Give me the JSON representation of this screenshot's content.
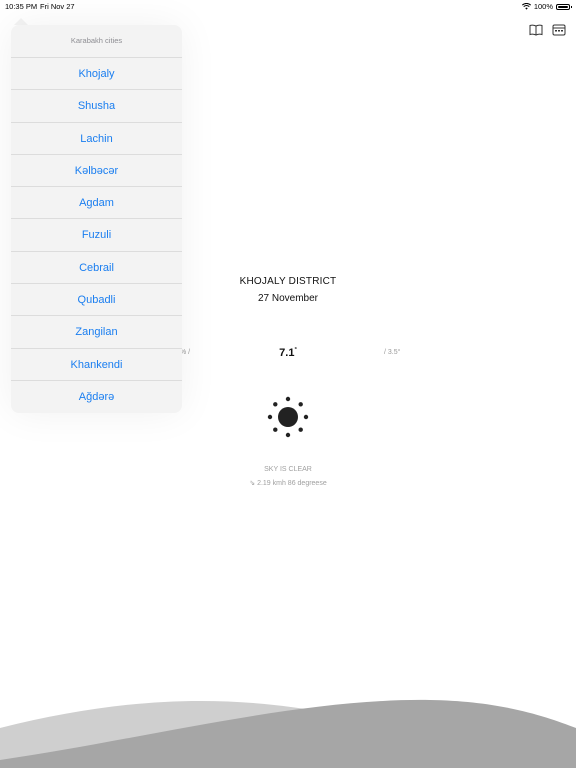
{
  "status": {
    "time": "10:35 PM",
    "date": "Fri Nov 27",
    "battery": "100%"
  },
  "weather": {
    "district": "KHOJALY DISTRICT",
    "date": "27 November",
    "humidity": "% /",
    "temperature": "7.1",
    "temp_unit": "°",
    "pressure": "/ 3.5°",
    "sky": "SKY IS CLEAR",
    "wind": "2.19 kmh 86 degreese"
  },
  "popover": {
    "title": "Karabakh cities",
    "cities": [
      "Khojaly",
      "Shusha",
      "Lachin",
      "Kəlbəcər",
      "Agdam",
      "Fuzuli",
      "Cebrail",
      "Qubadli",
      "Zangilan",
      "Khankendi",
      "Ağdərə"
    ]
  },
  "colors": {
    "link": "#1a7ef0",
    "wave_light": "#c8c8c8",
    "wave_dark": "#a8a8a8"
  }
}
